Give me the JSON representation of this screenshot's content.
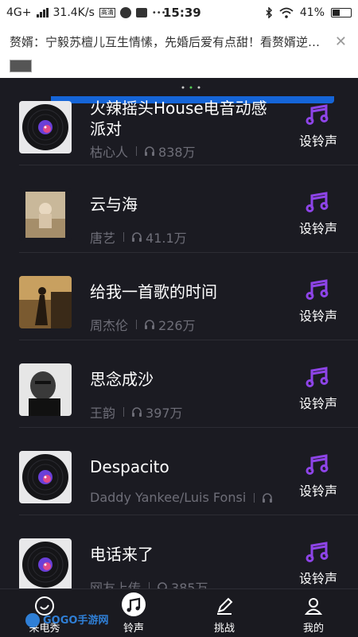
{
  "status_bar": {
    "network": "4G+",
    "speed": "31.4K/s",
    "hd_badge": "高清",
    "time": "15:39",
    "battery": "41%"
  },
  "notification": {
    "text": "赘婿：宁毅苏檀儿互生情愫，先婚后爱有点甜！看赘婿逆…",
    "close_icon": "close-icon"
  },
  "colors": {
    "accent": "#8e44e8",
    "background": "#1b1b22",
    "blue_bar": "#1565d8"
  },
  "songs": [
    {
      "title": "火辣摇头House电音动感派对",
      "artist": "枯心人",
      "plays": "838万",
      "action": "设铃声",
      "cover": "vinyl"
    },
    {
      "title": "云与海",
      "artist": "唐艺",
      "plays": "41.1万",
      "action": "设铃声",
      "cover": "photo-beige"
    },
    {
      "title": "给我一首歌的时间",
      "artist": "周杰伦",
      "plays": "226万",
      "action": "设铃声",
      "cover": "photo-sepia"
    },
    {
      "title": "思念成沙",
      "artist": "王韵",
      "plays": "397万",
      "action": "设铃声",
      "cover": "photo-bw"
    },
    {
      "title": "Despacito",
      "artist": "Daddy Yankee/Luis Fonsi",
      "plays": "",
      "action": "设铃声",
      "cover": "vinyl"
    },
    {
      "title": "电话来了",
      "artist": "网友上传",
      "plays": "385万",
      "action": "设铃声",
      "cover": "vinyl"
    }
  ],
  "tabs": [
    {
      "label": "来电秀",
      "icon": "phone-show-icon"
    },
    {
      "label": "铃声",
      "icon": "music-note-icon"
    },
    {
      "label": "挑战",
      "icon": "pencil-icon"
    },
    {
      "label": "我的",
      "icon": "user-icon"
    }
  ],
  "watermark": {
    "text": "GOGO手游网"
  }
}
